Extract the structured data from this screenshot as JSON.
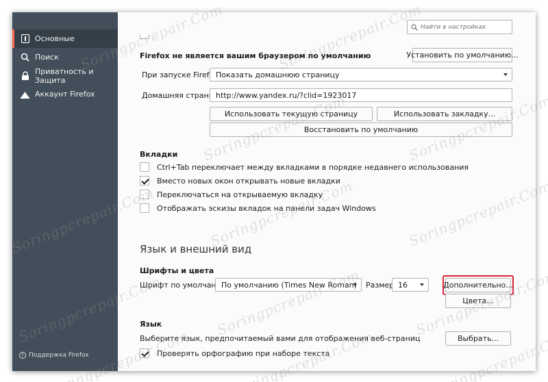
{
  "sidebar": {
    "items": [
      {
        "label": "Основные",
        "icon": "general-icon",
        "selected": true
      },
      {
        "label": "Поиск",
        "icon": "search-icon",
        "selected": false
      },
      {
        "label": "Приватность и Защита",
        "icon": "lock-icon",
        "selected": false
      },
      {
        "label": "Аккаунт Firefox",
        "icon": "account-icon",
        "selected": false
      }
    ],
    "support_label": "Поддержка Firefox"
  },
  "search": {
    "placeholder": "Найти в настройках"
  },
  "startup": {
    "default_browser_text": "Firefox не является вашим браузером по умолчанию",
    "set_default_label": "Установить по умолчанию...",
    "on_start_label": "При запуске Firefox",
    "on_start_value": "Показать домашнюю страницу",
    "homepage_label": "Домашняя страница",
    "homepage_value": "http://www.yandex.ru/?clid=1923017",
    "use_current_label": "Использовать текущую страницу",
    "use_bookmark_label": "Использовать закладку...",
    "restore_default_label": "Восстановить по умолчанию"
  },
  "tabs": {
    "heading": "Вкладки",
    "options": [
      {
        "label": "Ctrl+Tab переключает между вкладками в порядке недавнего использования",
        "checked": false
      },
      {
        "label": "Вместо новых окон открывать новые вкладки",
        "checked": true
      },
      {
        "label": "Переключаться на открываемую вкладку",
        "checked": false
      },
      {
        "label": "Отображать эскизы вкладок на панели задач Windows",
        "checked": false
      }
    ]
  },
  "language_appearance": {
    "heading": "Язык и внешний вид",
    "fonts_heading": "Шрифты и цвета",
    "default_font_label": "Шрифт по умолчанию",
    "default_font_value": "По умолчанию (Times New Roman)",
    "size_label": "Размер",
    "size_value": "16",
    "advanced_label": "Дополнительно...",
    "colors_label": "Цвета..."
  },
  "language": {
    "heading": "Язык",
    "description": "Выберите язык, предпочитаемый вами для отображения веб-страниц",
    "choose_label": "Выбрать...",
    "spellcheck_label": "Проверять орфографию при наборе текста",
    "spellcheck_checked": true
  },
  "watermark": "Soringpcrepair.Com",
  "colors": {
    "sidebar_bg": "#424f5a",
    "accent": "#ff6a4d",
    "highlight": "#d9243a"
  }
}
